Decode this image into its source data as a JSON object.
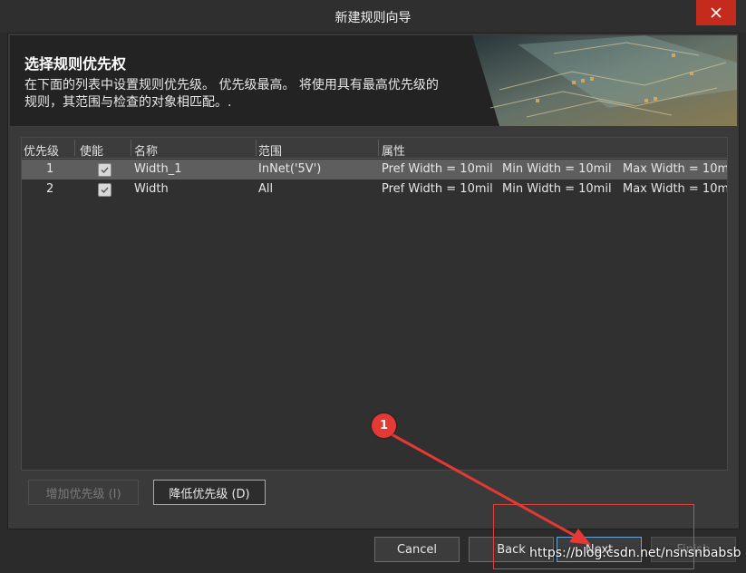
{
  "window": {
    "title": "新建规则向导"
  },
  "header": {
    "title": "选择规则优先权",
    "description": "在下面的列表中设置规则优先级。 优先级最高。 将使用具有最高优先级的规则，其范围与检查的对象相匹配。."
  },
  "table": {
    "columns": [
      "优先级",
      "使能",
      "名称",
      "范围",
      "属性"
    ],
    "rows": [
      {
        "priority": "1",
        "enabled": true,
        "name": "Width_1",
        "scope": "InNet('5V')",
        "pref": "Pref Width = 10mil",
        "min": "Min Width = 10mil",
        "max": "Max Width = 10m",
        "selected": true
      },
      {
        "priority": "2",
        "enabled": true,
        "name": "Width",
        "scope": "All",
        "pref": "Pref Width = 10mil",
        "min": "Min Width = 10mil",
        "max": "Max Width = 10m",
        "selected": false
      }
    ]
  },
  "priority_buttons": {
    "increase": "增加优先级 (I)",
    "decrease": "降低优先级 (D)"
  },
  "footer_buttons": {
    "cancel": "Cancel",
    "back": "Back",
    "next": "Next",
    "finish": "Finish"
  },
  "annotation": {
    "marker": "1"
  },
  "watermark": "https://blog.csdn.net/nsnsnbabsb",
  "colors": {
    "accent_red": "#e53935",
    "close_red": "#c42b1c",
    "selected_row": "#5e5e5e"
  }
}
